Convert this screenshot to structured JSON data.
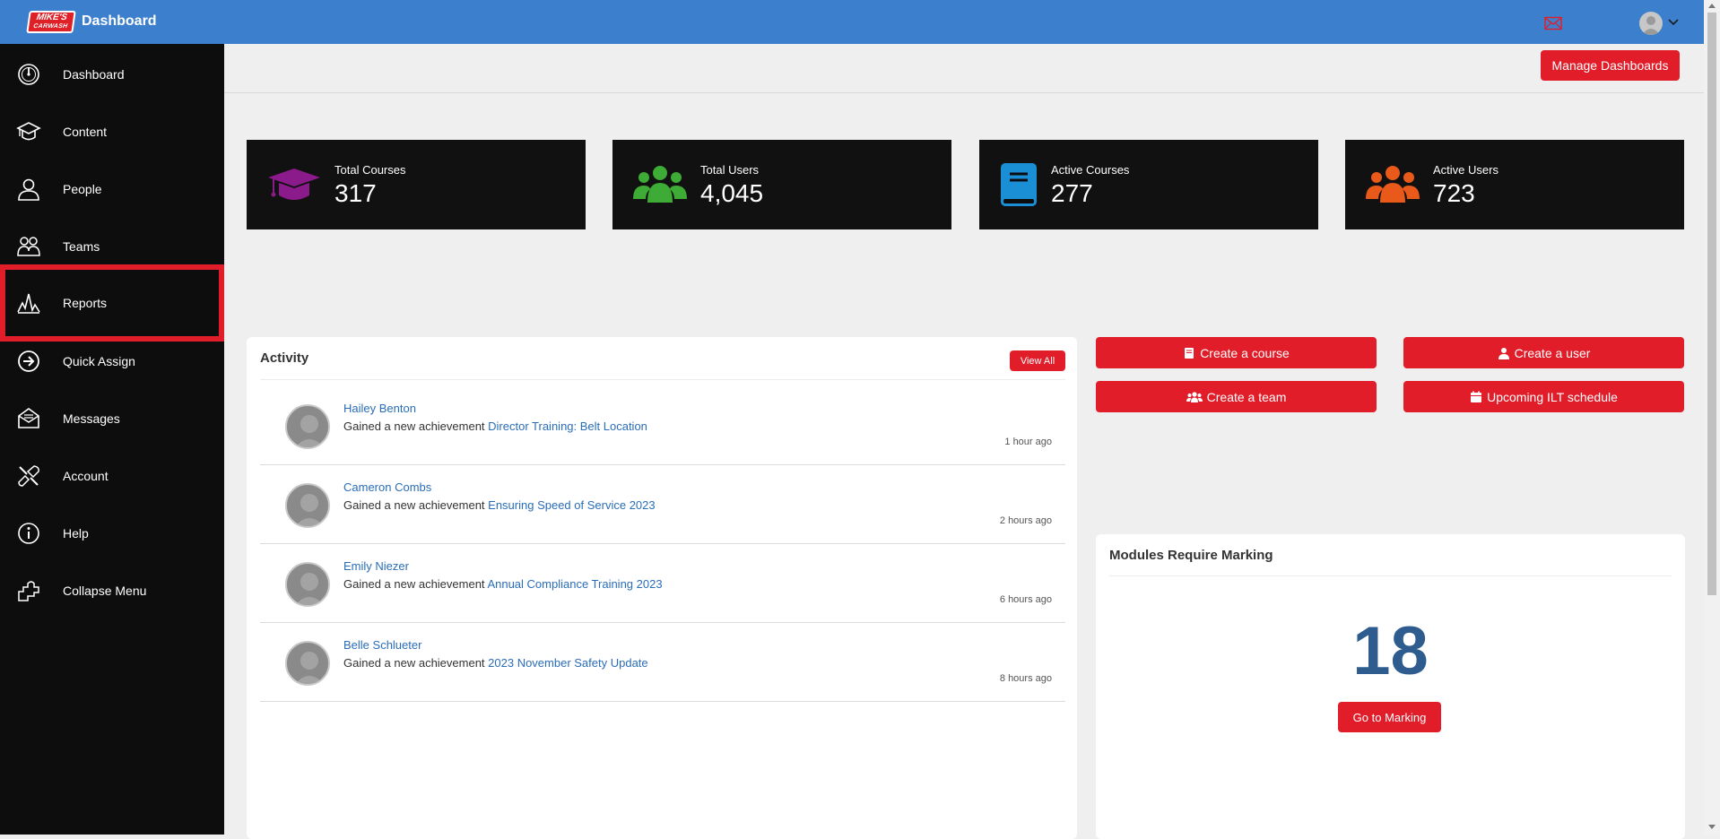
{
  "header": {
    "logo_line1": "MIKE'S",
    "logo_line2": "CARWASH",
    "title": "Dashboard",
    "icons": [
      "mail-icon",
      "avatar",
      "chevron-down-icon"
    ]
  },
  "sidebar": {
    "items": [
      {
        "label": "Dashboard",
        "icon": "dashboard-gauge-icon"
      },
      {
        "label": "Content",
        "icon": "graduation-cap-icon"
      },
      {
        "label": "People",
        "icon": "person-icon"
      },
      {
        "label": "Teams",
        "icon": "team-icon"
      },
      {
        "label": "Reports",
        "icon": "reports-chart-icon",
        "active": true
      },
      {
        "label": "Quick Assign",
        "icon": "arrow-circle-icon"
      },
      {
        "label": "Messages",
        "icon": "envelope-icon"
      },
      {
        "label": "Account",
        "icon": "tools-icon"
      },
      {
        "label": "Help",
        "icon": "info-icon"
      },
      {
        "label": "Collapse Menu",
        "icon": "collapse-icon"
      }
    ],
    "active_outline_color": "#e11d2a"
  },
  "toolbar": {
    "manage_label": "Manage Dashboards"
  },
  "stats": [
    {
      "title": "Total Courses",
      "value": "317",
      "icon": "graduation-cap-icon",
      "color": "#8b1a8b"
    },
    {
      "title": "Total Users",
      "value": "4,045",
      "icon": "users-icon",
      "color": "#3dab35"
    },
    {
      "title": "Active Courses",
      "value": "277",
      "icon": "book-icon",
      "color": "#1b8fd6"
    },
    {
      "title": "Active Users",
      "value": "723",
      "icon": "users-icon",
      "color": "#e8591a"
    }
  ],
  "activity": {
    "title": "Activity",
    "view_all": "View All",
    "items": [
      {
        "name": "Hailey Benton",
        "prefix": "Gained a new achievement ",
        "link": "Director Training: Belt Location",
        "time": "1 hour ago"
      },
      {
        "name": "Cameron Combs",
        "prefix": "Gained a new achievement ",
        "link": "Ensuring Speed of Service 2023",
        "time": "2 hours ago"
      },
      {
        "name": "Emily Niezer",
        "prefix": "Gained a new achievement ",
        "link": "Annual Compliance Training 2023",
        "time": "6 hours ago"
      },
      {
        "name": "Belle Schlueter",
        "prefix": "Gained a new achievement ",
        "link": "2023 November Safety Update",
        "time": "8 hours ago"
      }
    ]
  },
  "actions": {
    "create_course": "Create a course",
    "create_user": "Create a user",
    "create_team": "Create a team",
    "ilt_schedule": "Upcoming ILT schedule"
  },
  "marking": {
    "title": "Modules Require Marking",
    "count": "18",
    "button": "Go to Marking"
  },
  "colors": {
    "topbar": "#3c80cd",
    "sidebar": "#0d0d0d",
    "accent_red": "#e11d2a",
    "link_blue": "#2a6db8",
    "count_blue": "#2e5c8e"
  }
}
